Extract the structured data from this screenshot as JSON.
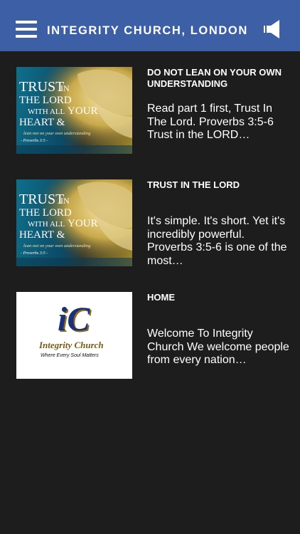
{
  "header": {
    "title": "INTEGRITY CHURCH, LONDON",
    "menu_icon": "hamburger-menu-icon",
    "audio_icon": "speaker-icon"
  },
  "posts": [
    {
      "title": "DO NOT LEAN ON YOUR OWN UNDERSTANDING",
      "excerpt": "Read part 1 first, Trust In The Lord. Proverbs 3:5-6 Trust in the LORD…",
      "image": {
        "line1a": "TRUST",
        "line1b": "IN",
        "line2": "THE LORD",
        "line3a": "WITH ALL",
        "line3b": "YOUR",
        "line4": "HEART &",
        "line5": "lean not on your own understanding",
        "line6": "- Proverbs 3:5 -"
      }
    },
    {
      "title": "TRUST IN THE LORD",
      "excerpt": "It's simple. It's short. Yet it's incredibly powerful. Proverbs 3:5-6 is one of the most…",
      "image": {
        "line1a": "TRUST",
        "line1b": "IN",
        "line2": "THE LORD",
        "line3a": "WITH ALL",
        "line3b": "YOUR",
        "line4": "HEART &",
        "line5": "lean not on your own understanding",
        "line6": "- Proverbs 3:5 -"
      }
    },
    {
      "title": "HOME",
      "excerpt": "Welcome To Integrity Church We welcome people from every nation…",
      "image": {
        "monogram": "iC",
        "name": "Integrity Church",
        "tagline": "Where Every Soul Matters"
      }
    }
  ],
  "colors": {
    "header_bg": "#3d5fa6",
    "page_bg": "#1d1d1d",
    "text": "#ffffff"
  }
}
